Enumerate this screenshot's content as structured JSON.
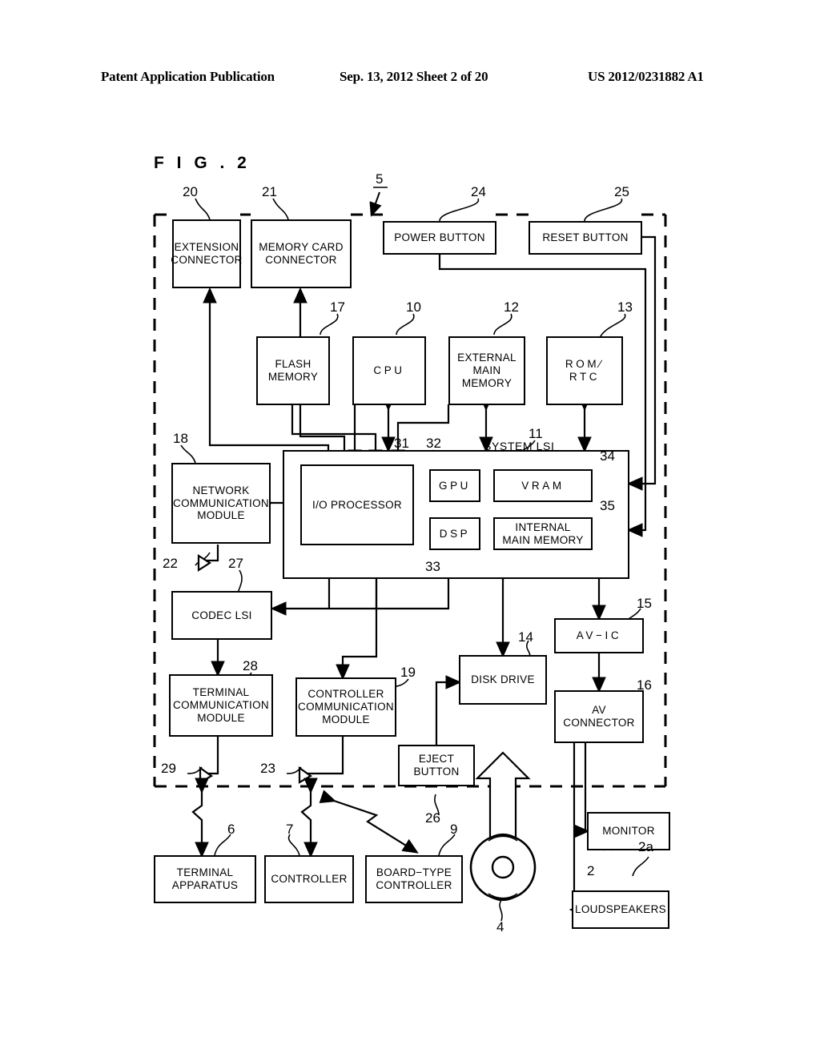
{
  "header": {
    "left": "Patent Application Publication",
    "middle": "Sep. 13, 2012  Sheet 2 of 20",
    "right": "US 2012/0231882 A1"
  },
  "figure": {
    "label": "F I G .  2",
    "system_boundary_ref": "5",
    "system_lsi_title": "SYSTEM LSI"
  },
  "blocks": [
    {
      "id": "extension_connector",
      "label": "EXTENSION\nCONNECTOR",
      "ref": "20"
    },
    {
      "id": "memory_card_connector",
      "label": "MEMORY CARD\nCONNECTOR",
      "ref": "21"
    },
    {
      "id": "power_button",
      "label": "POWER BUTTON",
      "ref": "24"
    },
    {
      "id": "reset_button",
      "label": "RESET BUTTON",
      "ref": "25"
    },
    {
      "id": "flash_memory",
      "label": "FLASH\nMEMORY",
      "ref": "17"
    },
    {
      "id": "cpu",
      "label": "CPU",
      "ref": "10"
    },
    {
      "id": "external_main_memory",
      "label": "EXTERNAL\nMAIN\nMEMORY",
      "ref": "12"
    },
    {
      "id": "rom_rtc",
      "label": "ROM∕\nRTC",
      "ref": "13"
    },
    {
      "id": "system_lsi",
      "label": "SYSTEM LSI",
      "ref": "11"
    },
    {
      "id": "io_processor",
      "label": "I/O PROCESSOR",
      "ref": "31"
    },
    {
      "id": "gpu",
      "label": "GPU",
      "ref": "32"
    },
    {
      "id": "vram",
      "label": "VRAM",
      "ref": "34"
    },
    {
      "id": "dsp",
      "label": "DSP",
      "ref": "33"
    },
    {
      "id": "internal_main_memory",
      "label": "INTERNAL\nMAIN MEMORY",
      "ref": "35"
    },
    {
      "id": "network_comm_module",
      "label": "NETWORK\nCOMMUNICATION\nMODULE",
      "ref": "18"
    },
    {
      "id": "network_antenna",
      "label": "",
      "ref": "22"
    },
    {
      "id": "codec_lsi",
      "label": "CODEC LSI",
      "ref": "27"
    },
    {
      "id": "terminal_comm_module",
      "label": "TERMINAL\nCOMMUNICATION\nMODULE",
      "ref": "28"
    },
    {
      "id": "terminal_antenna",
      "label": "",
      "ref": "29"
    },
    {
      "id": "controller_comm_module",
      "label": "CONTROLLER\nCOMMUNICATION\nMODULE",
      "ref": "19"
    },
    {
      "id": "controller_antenna",
      "label": "",
      "ref": "23"
    },
    {
      "id": "eject_button",
      "label": "EJECT\nBUTTON",
      "ref": "26"
    },
    {
      "id": "disk_drive",
      "label": "DISK DRIVE",
      "ref": "14"
    },
    {
      "id": "av_ic",
      "label": "AV−IC",
      "ref": "15"
    },
    {
      "id": "av_connector",
      "label": "AV\nCONNECTOR",
      "ref": "16"
    },
    {
      "id": "terminal_apparatus",
      "label": "TERMINAL\nAPPARATUS",
      "ref": "6"
    },
    {
      "id": "controller",
      "label": "CONTROLLER",
      "ref": "7"
    },
    {
      "id": "board_type_controller",
      "label": "BOARD−TYPE\nCONTROLLER",
      "ref": "9"
    },
    {
      "id": "optical_disk",
      "label": "",
      "ref": "4"
    },
    {
      "id": "monitor",
      "label": "MONITOR",
      "ref": "2"
    },
    {
      "id": "loudspeakers",
      "label": "LOUDSPEAKERS",
      "ref": "2a"
    }
  ],
  "labels": {
    "extension_connector": "EXTENSION\nCONNECTOR",
    "memory_card_connector": "MEMORY CARD\nCONNECTOR",
    "power_button": "POWER BUTTON",
    "reset_button": "RESET BUTTON",
    "flash_memory": "FLASH\nMEMORY",
    "cpu": "CPU",
    "external_main_memory": "EXTERNAL\nMAIN\nMEMORY",
    "rom_rtc": "ROM∕\nRTC",
    "io_processor": "I/O PROCESSOR",
    "gpu": "GPU",
    "vram": "VRAM",
    "dsp": "DSP",
    "internal_main_memory": "INTERNAL\nMAIN MEMORY",
    "network_comm_module": "NETWORK\nCOMMUNICATION\nMODULE",
    "codec_lsi": "CODEC LSI",
    "terminal_comm_module": "TERMINAL\nCOMMUNICATION\nMODULE",
    "controller_comm_module": "CONTROLLER\nCOMMUNICATION\nMODULE",
    "eject_button": "EJECT\nBUTTON",
    "disk_drive": "DISK DRIVE",
    "av_ic": "AV−IC",
    "av_connector": "AV\nCONNECTOR",
    "terminal_apparatus": "TERMINAL\nAPPARATUS",
    "controller": "CONTROLLER",
    "board_type_controller": "BOARD−TYPE\nCONTROLLER",
    "monitor": "MONITOR",
    "loudspeakers": "LOUDSPEAKERS"
  },
  "refs": {
    "extension_connector": "20",
    "memory_card_connector": "21",
    "system_boundary": "5",
    "power_button": "24",
    "reset_button": "25",
    "flash_memory": "17",
    "cpu": "10",
    "external_main_memory": "12",
    "rom_rtc": "13",
    "system_lsi": "11",
    "io_processor": "31",
    "gpu": "32",
    "vram": "34",
    "dsp": "33",
    "internal_main_memory": "35",
    "network_comm_module": "18",
    "network_antenna": "22",
    "codec_lsi": "27",
    "terminal_comm_module": "28",
    "terminal_antenna": "29",
    "controller_comm_module": "19",
    "controller_antenna": "23",
    "eject_button": "26",
    "disk_drive": "14",
    "av_ic": "15",
    "av_connector": "16",
    "terminal_apparatus": "6",
    "controller": "7",
    "board_type_controller": "9",
    "optical_disk": "4",
    "monitor": "2",
    "loudspeakers": "2a"
  }
}
